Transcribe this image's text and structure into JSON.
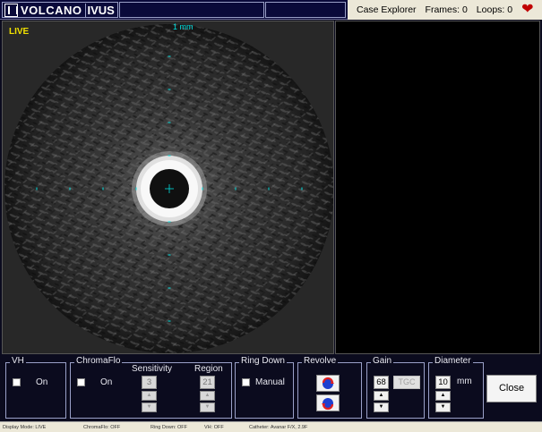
{
  "header": {
    "logo_brand": "VOLCANO",
    "logo_product": "IVUS",
    "case_explorer_label": "Case Explorer",
    "frames_label": "Frames: 0",
    "loops_label": "Loops: 0",
    "heart_icon": "heart-icon",
    "heart_color": "#c00000"
  },
  "image_view": {
    "mode_label": "LIVE",
    "scale_label": "1 mm",
    "marker_color": "#00e0e0"
  },
  "controls": {
    "vh": {
      "title": "VH",
      "on_label": "On"
    },
    "chromaflo": {
      "title": "ChromaFlo",
      "on_label": "On",
      "sensitivity_label": "Sensitivity",
      "sensitivity_value": "3",
      "region_label": "Region",
      "region_value": "21"
    },
    "ring_down": {
      "title": "Ring Down",
      "manual_label": "Manual"
    },
    "revolve": {
      "title": "Revolve"
    },
    "gain": {
      "title": "Gain",
      "value": "68",
      "tgc_label": "TGC"
    },
    "diameter": {
      "title": "Diameter",
      "value": "10",
      "unit": "mm"
    },
    "close_label": "Close"
  },
  "statusbar": {
    "display_mode": "Display Mode: LIVE",
    "chromaflo": "ChromaFlo: OFF",
    "ring_down": "Ring Down: OFF",
    "vh": "VH: OFF",
    "catheter": "Catheter: Avanar F/X, 2.9F"
  }
}
